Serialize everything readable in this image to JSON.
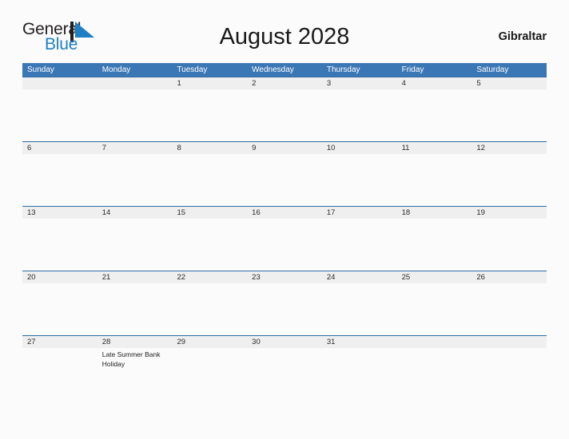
{
  "brand": {
    "name_part1": "General",
    "name_part2": "Blue",
    "flag_icon": "blue-flag-triangle-icon",
    "color_dark": "#231f20",
    "color_blue": "#1f7fc4"
  },
  "header": {
    "title": "August 2028",
    "country": "Gibraltar"
  },
  "theme": {
    "header_blue": "#3c77b5",
    "row_line_blue": "#2e6da4",
    "number_band_gray": "#efefef",
    "page_background": "#fbfbfc",
    "text_dark": "#1a1a1a"
  },
  "calendar": {
    "day_headers": [
      "Sunday",
      "Monday",
      "Tuesday",
      "Wednesday",
      "Thursday",
      "Friday",
      "Saturday"
    ],
    "weeks": [
      {
        "days": [
          {
            "number": "",
            "event": ""
          },
          {
            "number": "",
            "event": ""
          },
          {
            "number": "1",
            "event": ""
          },
          {
            "number": "2",
            "event": ""
          },
          {
            "number": "3",
            "event": ""
          },
          {
            "number": "4",
            "event": ""
          },
          {
            "number": "5",
            "event": ""
          }
        ]
      },
      {
        "days": [
          {
            "number": "6",
            "event": ""
          },
          {
            "number": "7",
            "event": ""
          },
          {
            "number": "8",
            "event": ""
          },
          {
            "number": "9",
            "event": ""
          },
          {
            "number": "10",
            "event": ""
          },
          {
            "number": "11",
            "event": ""
          },
          {
            "number": "12",
            "event": ""
          }
        ]
      },
      {
        "days": [
          {
            "number": "13",
            "event": ""
          },
          {
            "number": "14",
            "event": ""
          },
          {
            "number": "15",
            "event": ""
          },
          {
            "number": "16",
            "event": ""
          },
          {
            "number": "17",
            "event": ""
          },
          {
            "number": "18",
            "event": ""
          },
          {
            "number": "19",
            "event": ""
          }
        ]
      },
      {
        "days": [
          {
            "number": "20",
            "event": ""
          },
          {
            "number": "21",
            "event": ""
          },
          {
            "number": "22",
            "event": ""
          },
          {
            "number": "23",
            "event": ""
          },
          {
            "number": "24",
            "event": ""
          },
          {
            "number": "25",
            "event": ""
          },
          {
            "number": "26",
            "event": ""
          }
        ]
      },
      {
        "days": [
          {
            "number": "27",
            "event": ""
          },
          {
            "number": "28",
            "event": "Late Summer Bank Holiday"
          },
          {
            "number": "29",
            "event": ""
          },
          {
            "number": "30",
            "event": ""
          },
          {
            "number": "31",
            "event": ""
          },
          {
            "number": "",
            "event": ""
          },
          {
            "number": "",
            "event": ""
          }
        ]
      }
    ]
  }
}
